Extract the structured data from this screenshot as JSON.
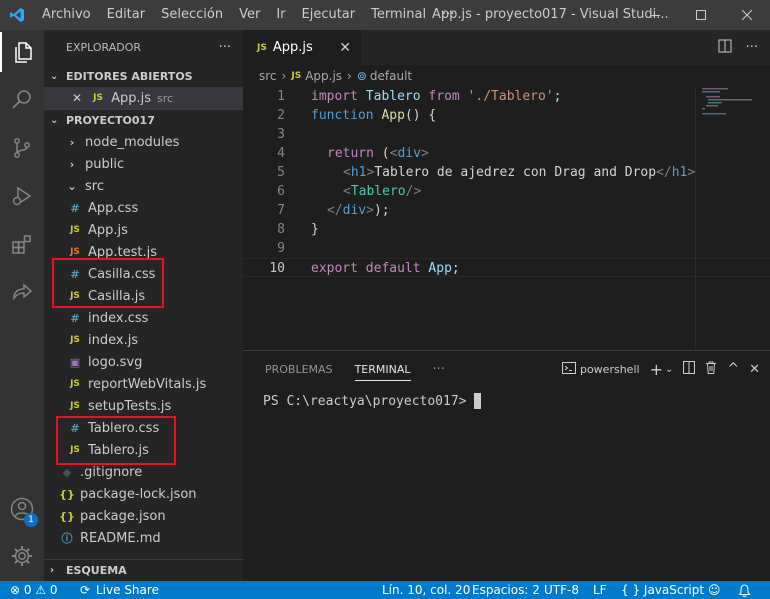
{
  "titlebar": {
    "menu": [
      "Archivo",
      "Editar",
      "Selección",
      "Ver",
      "Ir",
      "Ejecutar",
      "Terminal",
      "···"
    ],
    "title": "App.js - proyecto017 - Visual Studi..."
  },
  "activity": {
    "icons": [
      "explorer-icon",
      "search-icon",
      "source-control-icon",
      "run-debug-icon",
      "extensions-icon",
      "live-share-icon",
      "accounts-icon",
      "settings-gear-icon"
    ],
    "accounts_badge": "1"
  },
  "sidebar": {
    "header": "EXPLORADOR",
    "header_more": "···",
    "open_editors_title": "EDITORES ABIERTOS",
    "open_editor": {
      "close": "✕",
      "icon": "JS",
      "name": "App.js",
      "folder": "src"
    },
    "project_title": "PROYECTO017",
    "items": [
      {
        "icon": "›",
        "name": "node_modules",
        "kind": "folder"
      },
      {
        "icon": "›",
        "name": "public",
        "kind": "folder"
      },
      {
        "icon": "⌄",
        "name": "src",
        "kind": "folder"
      },
      {
        "icon": "#",
        "name": "App.css",
        "kind": "css"
      },
      {
        "icon": "JS",
        "name": "App.js",
        "kind": "js"
      },
      {
        "icon": "JS",
        "name": "App.test.js",
        "kind": "jstest"
      },
      {
        "icon": "#",
        "name": "Casilla.css",
        "kind": "css"
      },
      {
        "icon": "JS",
        "name": "Casilla.js",
        "kind": "js"
      },
      {
        "icon": "#",
        "name": "index.css",
        "kind": "css"
      },
      {
        "icon": "JS",
        "name": "index.js",
        "kind": "js"
      },
      {
        "icon": "▣",
        "name": "logo.svg",
        "kind": "svg"
      },
      {
        "icon": "JS",
        "name": "reportWebVitals.js",
        "kind": "js"
      },
      {
        "icon": "JS",
        "name": "setupTests.js",
        "kind": "js"
      },
      {
        "icon": "#",
        "name": "Tablero.css",
        "kind": "css"
      },
      {
        "icon": "JS",
        "name": "Tablero.js",
        "kind": "js"
      },
      {
        "icon": "◆",
        "name": ".gitignore",
        "kind": "git"
      },
      {
        "icon": "{}",
        "name": "package-lock.json",
        "kind": "json"
      },
      {
        "icon": "{}",
        "name": "package.json",
        "kind": "json"
      },
      {
        "icon": "ⓘ",
        "name": "README.md",
        "kind": "info"
      }
    ],
    "outline_title": "ESQUEMA"
  },
  "editor": {
    "tab": {
      "icon": "JS",
      "label": "App.js",
      "close": "✕"
    },
    "breadcrumb": {
      "folder": "src",
      "file_icon": "JS",
      "file": "App.js",
      "symbol": "default"
    },
    "lines": [
      {
        "n": "1"
      },
      {
        "n": "2"
      },
      {
        "n": "3"
      },
      {
        "n": "4"
      },
      {
        "n": "5"
      },
      {
        "n": "6"
      },
      {
        "n": "7"
      },
      {
        "n": "8"
      },
      {
        "n": "9"
      },
      {
        "n": "10"
      }
    ],
    "code": {
      "l1_import": "import",
      "l1_name": " Tablero ",
      "l1_from": "from",
      "l1_str": " './Tablero'",
      "l1_end": ";",
      "l2_function": "function",
      "l2_name": " App",
      "l2_end": "() {",
      "l4_return": "return",
      "l4_paren": " (",
      "l4_open": "<",
      "l4_tag": "div",
      "l4_close": ">",
      "l5_open": "<",
      "l5_tag": "h1",
      "l5_close": ">",
      "l5_text": "Tablero de ajedrez con Drag and Drop",
      "l5_eopen": "</",
      "l5_etag": "h1",
      "l5_eclose": ">",
      "l6_open": "<",
      "l6_tag": "Tablero",
      "l6_close": "/>",
      "l7_open": "</",
      "l7_tag": "div",
      "l7_close": ">",
      "l7_end": ");",
      "l8_brace": "}",
      "l10_export": "export",
      "l10_default": " default",
      "l10_name": " App",
      "l10_end": ";"
    }
  },
  "panel": {
    "tabs": [
      "PROBLEMAS",
      "TERMINAL",
      "···"
    ],
    "shell": "powershell",
    "prompt": "PS C:\\reactya\\proyecto017>"
  },
  "status": {
    "errors": "⊗ 0 ⚠ 0",
    "live_share": "Live Share",
    "position": "Lín. 10, col. 20",
    "spaces": "Espacios: 2",
    "encoding": "UTF-8",
    "eol": "LF",
    "language": "{ } JavaScript"
  },
  "colors": {
    "accent": "#007acc",
    "highlight_box": "#e81123"
  }
}
